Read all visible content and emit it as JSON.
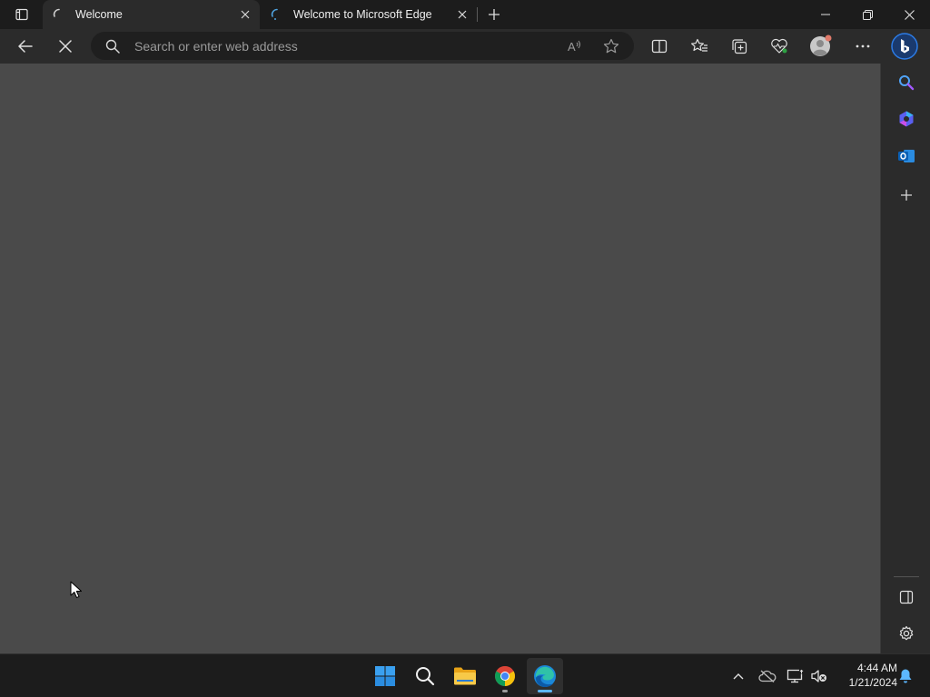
{
  "tabs": [
    {
      "title": "Welcome",
      "active": true,
      "loading": true
    },
    {
      "title": "Welcome to Microsoft Edge",
      "active": false,
      "loading": true
    }
  ],
  "address_bar": {
    "placeholder": "Search or enter web address",
    "value": ""
  },
  "toolbar_icons": [
    "back-icon",
    "stop-loading-icon",
    "read-aloud-icon",
    "add-favorite-icon",
    "split-screen-icon",
    "favorites-icon",
    "collections-icon",
    "browser-essentials-icon",
    "profile-avatar",
    "more-icon",
    "bing-copilot-icon"
  ],
  "sidebar_icons": [
    "search-icon",
    "copilot-icon",
    "outlook-icon",
    "add-icon",
    "hide-sidebar-icon",
    "settings-icon"
  ],
  "taskbar": {
    "apps": [
      "windows-start-icon",
      "search-icon",
      "file-explorer-icon",
      "chrome-icon",
      "edge-icon"
    ],
    "time": "4:44 AM",
    "date": "1/21/2024"
  },
  "colors": {
    "page_bg": "#4a4a4a",
    "chrome_bg": "#2b2b2b",
    "titlebar_bg": "#1c1c1c",
    "accent": "#0078d4"
  }
}
